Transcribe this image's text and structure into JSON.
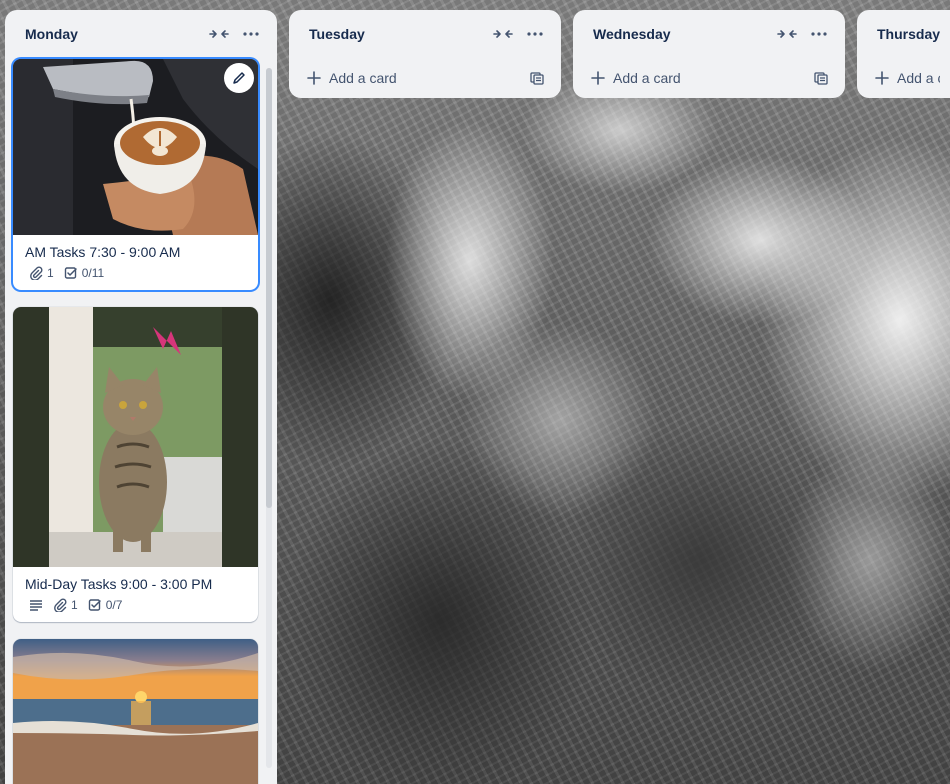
{
  "board": {
    "background_icon": "mountain-photo"
  },
  "lists": {
    "monday": {
      "title": "Monday",
      "cards": {
        "c1": {
          "title": "AM Tasks 7:30 - 9:00 AM",
          "cover": "latte-art-photo",
          "attachments": "1",
          "checklist": "0/11"
        },
        "c2": {
          "title": "Mid-Day Tasks 9:00 - 3:00 PM",
          "cover": "tabby-cat-photo",
          "attachments": "1",
          "checklist": "0/7"
        },
        "c3": {
          "cover": "beach-sunset-photo"
        }
      }
    },
    "tuesday": {
      "title": "Tuesday",
      "add_card": "Add a card"
    },
    "wednesday": {
      "title": "Wednesday",
      "add_card": "Add a card"
    },
    "thursday": {
      "title": "Thursday",
      "add_card": "Add a c"
    }
  },
  "icons": {
    "collapse": "collapse-arrows-icon",
    "menu": "more-dots-icon",
    "add": "plus-icon",
    "template": "card-template-icon",
    "attachment": "paperclip-icon",
    "checklist": "checkbox-icon",
    "description": "description-lines-icon",
    "edit": "pencil-icon"
  },
  "colors": {
    "list_bg": "#f1f2f4",
    "title_text": "#172b4d",
    "subtle_text": "#44546f",
    "focus_ring": "#388bff"
  }
}
